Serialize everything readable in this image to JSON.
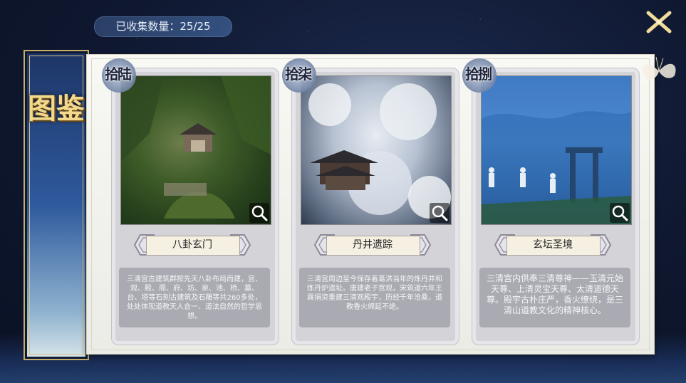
{
  "header": {
    "collected_label": "已收集数量：25/25"
  },
  "sidebar": {
    "title": "图鉴"
  },
  "cards": [
    {
      "badge": "拾陆",
      "name": "八卦玄门",
      "description": "三清宫古建筑群按先天八卦布局而建，宫、观、殿、阁、府、坊、泉、池、桥、墓、台、塔等石刻古建筑及石雕等共260多处，处处体现道教天人合一、道法自然的哲学思想。"
    },
    {
      "badge": "拾柒",
      "name": "丹井遗踪",
      "description": "三清宫周边至今保存着葛洪当年的炼丹井和炼丹炉遗址。唐建老子宫观，宋筑道六年王霖捐资重建三清观殿宇，历经千年沧桑，道教香火绵延不绝。"
    },
    {
      "badge": "拾捌",
      "name": "玄坛圣境",
      "description": "三清宫内供奉三清尊神——玉清元始天尊、上清灵宝天尊、太清道德天尊。殿宇古朴庄严，香火缭绕，是三清山道教文化的精神核心。"
    }
  ],
  "icons": {
    "close": "close-x-icon",
    "zoom": "magnifier-icon"
  },
  "colors": {
    "title_gold": "#f3d98e",
    "panel_bg": "#f8f8f4",
    "card_bg": "#d4d4d8",
    "desc_bg": "#aaabb2"
  }
}
